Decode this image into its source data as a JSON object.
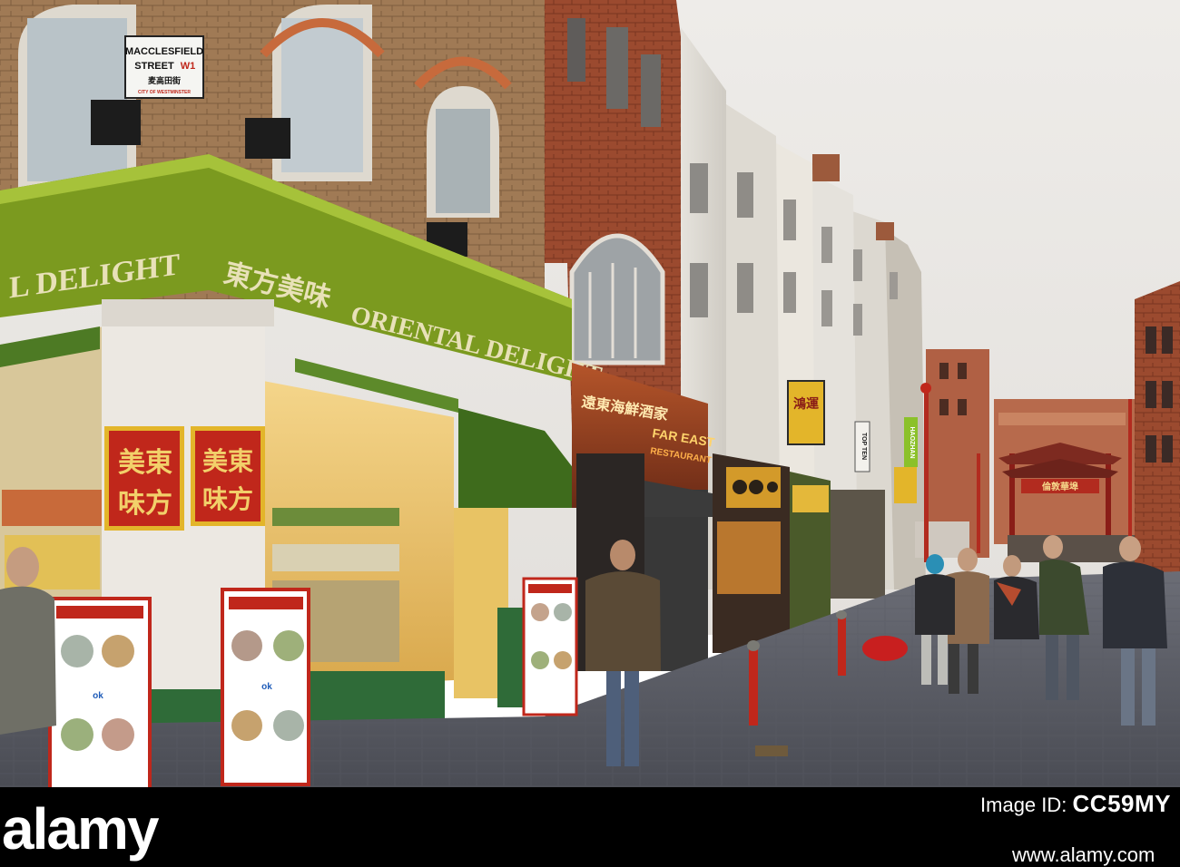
{
  "photo": {
    "street_sign": {
      "line1": "MACCLESFIELD",
      "line2": "STREET",
      "line2_suffix": "W1",
      "chinese": "麦高田街",
      "city": "CITY OF WESTMINSTER"
    },
    "fascia": {
      "english_left": "L DELIGHT",
      "chinese": "東方美味",
      "english_right": "ORIENTAL DELIGHT"
    },
    "pillar_signs": [
      {
        "col1": "美東",
        "col2": "味方"
      },
      {
        "col1": "美東",
        "col2": "味方"
      }
    ],
    "restaurant": {
      "chinese": "遠東海鮮酒家",
      "name": "FAR EAST",
      "sub": "RESTAURANT"
    },
    "hanging_sign": "鴻運",
    "vertical_sign_1": "TOP TEN",
    "vertical_sign_2": "HAOZHAN",
    "gate_text": "倫敦華埠",
    "gumball_brand": "ok"
  },
  "watermark": {
    "brand_name": "alamy",
    "image_id_label": "Image ID:",
    "image_id_value": "CC59MY",
    "url": "www.alamy.com"
  },
  "colors": {
    "fascia_green": "#7b9a1f",
    "sign_red": "#c0271b",
    "sign_yellow": "#e3b52a",
    "awning_green": "#3e6b1c",
    "brick": "#8a5236",
    "sky": "#e9e7e4",
    "footer": "#000000"
  }
}
